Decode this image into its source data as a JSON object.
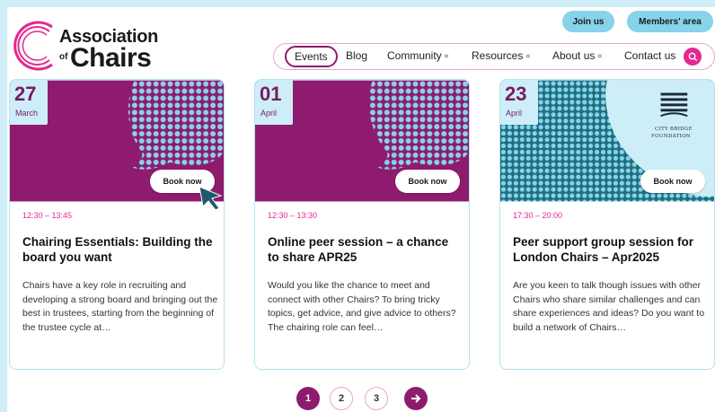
{
  "header": {
    "logo_line1": "Association",
    "logo_of": "of",
    "logo_line2": "Chairs",
    "join_label": "Join us",
    "members_label": "Members' area"
  },
  "nav": {
    "items": [
      {
        "label": "Events",
        "active": true
      },
      {
        "label": "Blog"
      },
      {
        "label": "Community ▫"
      },
      {
        "label": "Resources ▫"
      },
      {
        "label": "About us ▫"
      },
      {
        "label": "Contact us"
      }
    ],
    "search_icon": "search-icon"
  },
  "cards": [
    {
      "day": "27",
      "month": "March",
      "book_label": "Book now",
      "time": "12:30 – 13:45",
      "title": "Chairing Essentials: Building the board you want",
      "description": "Chairs have a key role in recruiting and developing a strong board and bringing out the best in trustees, starting from the beginning of the trustee cycle at…",
      "image_color": "#8e1b6e"
    },
    {
      "day": "01",
      "month": "April",
      "book_label": "Book now",
      "time": "12:30 – 13:30",
      "title": "Online peer session – a chance to share APR25",
      "description": "Would you like the chance to meet and connect with other Chairs? To bring tricky topics, get advice, and give advice to others? The chairing role can feel…",
      "image_color": "#8e1b6e"
    },
    {
      "day": "23",
      "month": "April",
      "book_label": "Book now",
      "time": "17:30 – 20:00",
      "title": "Peer support group session for London Chairs – Apr2025",
      "description": "Are you keen to talk though issues with other Chairs who share similar challenges and can share experiences and ideas? Do you want to build a network of Chairs…",
      "image_color": "#1e6e7e",
      "sponsor_line1": "CITY BRIDGE",
      "sponsor_line2": "FOUNDATION"
    }
  ],
  "pagination": {
    "pages": [
      "1",
      "2",
      "3"
    ],
    "current": "1",
    "next_icon": "arrow-right-icon"
  },
  "colors": {
    "brand_purple": "#8e1b6e",
    "brand_pink": "#e6278f",
    "light_blue": "#86d3ea",
    "teal": "#1e6e7e"
  }
}
